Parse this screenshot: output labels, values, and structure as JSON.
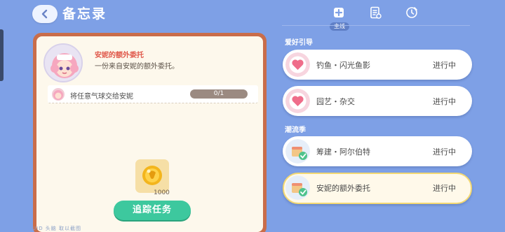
{
  "header": {
    "title": "备忘录",
    "tabs": [
      {
        "icon": "main-quest-icon",
        "label": "主线",
        "active": true
      },
      {
        "icon": "task-list-icon",
        "label": ""
      },
      {
        "icon": "clock-icon",
        "label": ""
      }
    ]
  },
  "detail": {
    "quest_name": "安妮的额外委托",
    "description": "一份来自安妮的额外委托。",
    "objective": {
      "text": "将任意气球交给安妮",
      "progress": "0/1"
    },
    "reward": {
      "icon": "gold-coin-icon",
      "count": "1000"
    },
    "track_button": "追踪任务"
  },
  "sections": [
    {
      "title": "爱好引导",
      "items": [
        {
          "name": "钓鱼・闪光鱼影",
          "status": "进行中",
          "icon": "heart-bubble-icon"
        },
        {
          "name": "园艺・杂交",
          "status": "进行中",
          "icon": "heart-bubble-icon"
        }
      ]
    },
    {
      "title": "潮流季",
      "items": [
        {
          "name": "筹建・阿尔伯特",
          "status": "进行中",
          "icon": "cake-check-icon"
        },
        {
          "name": "安妮的额外委托",
          "status": "进行中",
          "icon": "cake-check-icon",
          "selected": true
        }
      ]
    }
  ],
  "footer": {
    "watermark": "UID 头脑 取以截图"
  },
  "colors": {
    "background": "#7ea0e6",
    "panel_border": "#c96d4a",
    "panel_fill": "#fdf8ec",
    "accent_green": "#3dc89e",
    "quest_name_red": "#e0584a",
    "selected_border": "#f3d873"
  }
}
